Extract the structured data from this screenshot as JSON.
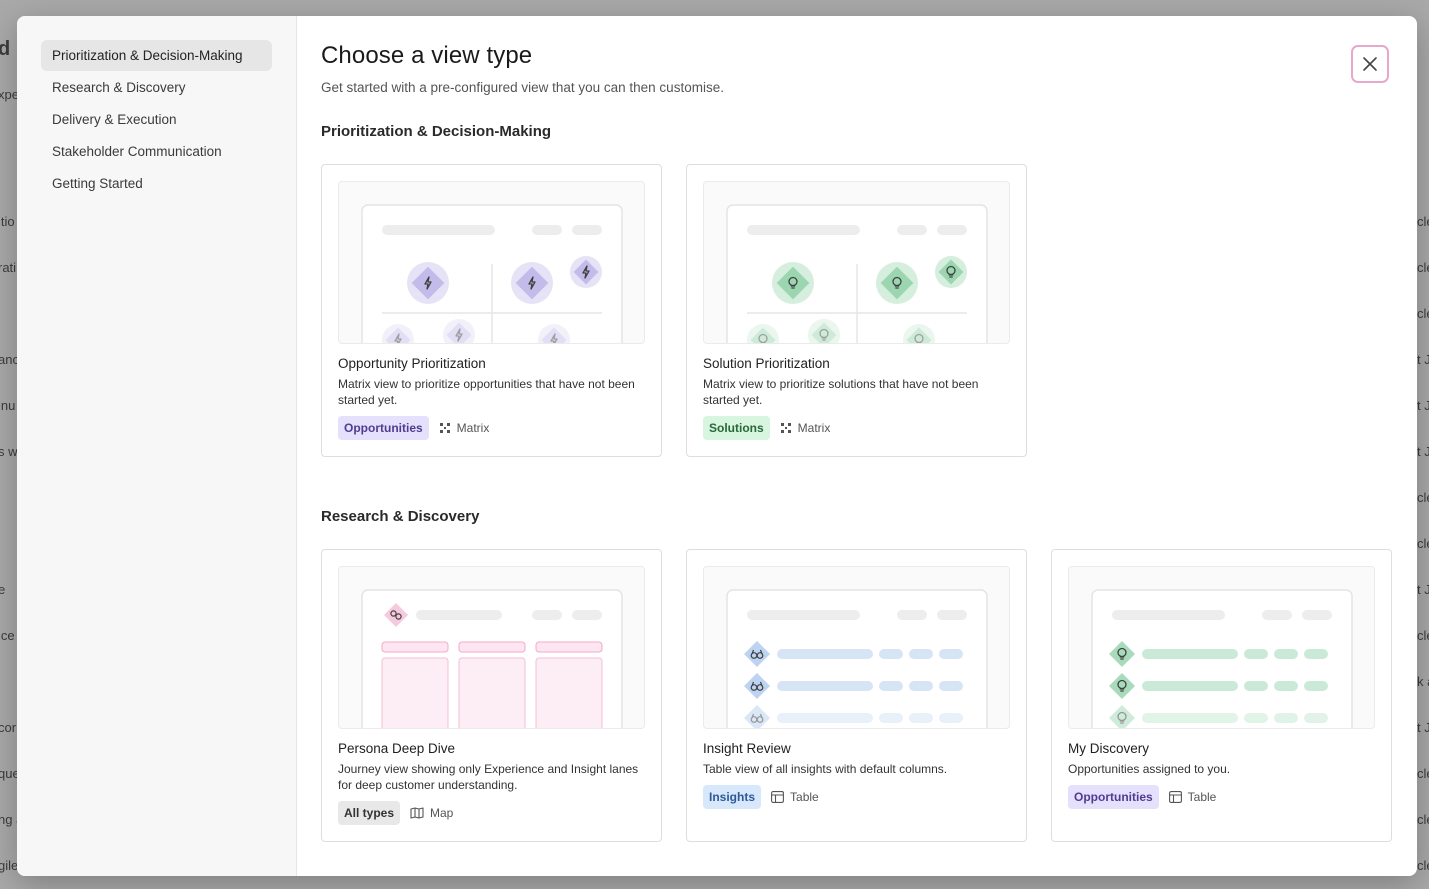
{
  "background": {
    "left_fragments": [
      "d",
      "xpe",
      "itio",
      "rati",
      "anc",
      "inu",
      "s w",
      "e",
      "ice",
      "cor",
      "que",
      "ng a",
      "gile"
    ],
    "right_fragments": [
      "cle",
      "cle",
      "cle",
      "t Ju",
      "t Ju",
      "t Ju",
      "cle",
      "cle",
      "t Ju",
      "cle",
      "k a",
      "t Ju",
      "cle",
      "cle",
      "cle"
    ]
  },
  "sidebar": {
    "items": [
      {
        "label": "Prioritization & Decision-Making",
        "active": true
      },
      {
        "label": "Research & Discovery",
        "active": false
      },
      {
        "label": "Delivery & Execution",
        "active": false
      },
      {
        "label": "Stakeholder Communication",
        "active": false
      },
      {
        "label": "Getting Started",
        "active": false
      }
    ]
  },
  "header": {
    "title": "Choose a view type",
    "subtitle": "Get started with a pre-configured view that you can then customise."
  },
  "close_icon": "close-icon",
  "sections": [
    {
      "title": "Prioritization & Decision-Making",
      "cards": [
        {
          "title": "Opportunity Prioritization",
          "description": "Matrix view to prioritize opportunities that have not been started yet.",
          "badge": "Opportunities",
          "view_type": "Matrix",
          "view_icon": "matrix-icon",
          "entity_icon": "lightning-icon",
          "color": "#8b7fd8"
        },
        {
          "title": "Solution Prioritization",
          "description": "Matrix view to prioritize solutions that have not been started yet.",
          "badge": "Solutions",
          "view_type": "Matrix",
          "view_icon": "matrix-icon",
          "entity_icon": "lightbulb-icon",
          "color": "#3fb06a"
        }
      ]
    },
    {
      "title": "Research & Discovery",
      "cards": [
        {
          "title": "Persona Deep Dive",
          "description": "Journey view showing only Experience and Insight lanes for deep customer understanding.",
          "badge": "All types",
          "view_type": "Map",
          "view_icon": "map-icon",
          "entity_icon": "persona-icon",
          "color": "#e88ab8"
        },
        {
          "title": "Insight Review",
          "description": "Table view of all insights with default columns.",
          "badge": "Insights",
          "view_type": "Table",
          "view_icon": "table-icon",
          "entity_icon": "binoculars-icon",
          "color": "#6b9ee0"
        },
        {
          "title": "My Discovery",
          "description": "Opportunities assigned to you.",
          "badge": "Opportunities",
          "view_type": "Table",
          "view_icon": "table-icon",
          "entity_icon": "lightbulb-icon",
          "color": "#3fb06a"
        }
      ]
    }
  ]
}
